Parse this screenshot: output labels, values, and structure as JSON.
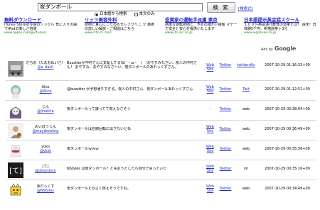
{
  "search": {
    "query": "炭ダンボール",
    "button_label": "検 索",
    "help_link": "[検索式]",
    "option_japanese": "日本語から検索",
    "option_fulltext": "本文のみ"
  },
  "ads": [
    {
      "title": "無料ダウンロード",
      "body": "iTunes Storeの今週のシングル 気に入りの曲でiPodの楽しさ倍増",
      "url": "www.apple.com/jp/itunes/"
    },
    {
      "title": "リッツ美容外科",
      "body": "技術と真心にこだわるセレブクリニ ク 施術の詳しい解説・ご相談はこちら",
      "url": "www.ritz-cs.com"
    },
    {
      "title": "投資家の運転手派遣 東京",
      "body": "高度な運転技術と、きめの細かい接客 マナーで安全と安心を提供いたします",
      "url": "www.jts-inc.co.jp"
    },
    {
      "title": "日本語提示英会話スクール",
      "body": "１００％英語漬け教育の効果とは？ 週末！日体験5千円、新宿説参ヶ3分",
      "url": "www.eigozuke.co.jp"
    }
  ],
  "ads_by": {
    "prefix": "Ads by",
    "brand": "Google"
  },
  "tweets": [
    {
      "name": "だちお（たまおねいさ）",
      "handle": "@a_dach",
      "text": "Buzztterが中村さんに支配してるね(´・ω・｀) 「おやすみなさい、炭人の中村さん！ おやすみ、おやすみなさ〜い、炭ダンボールのあれっくすさん。",
      "web": "Web Site",
      "twitter": "Twitter",
      "source": "twitterrific",
      "time": "2007-10-29 01:16:33+09"
    },
    {
      "name": "Alce",
      "handle": "@Alice",
      "text": "@buzztter が予想通りすぎる。炭人の中村さん、炭ダンボールあれっくすさん",
      "web": "Web Site",
      "twitter": "Twitter",
      "source": "Twit",
      "time": "2007-10-29 01:12:51+09"
    },
    {
      "name": "じん",
      "handle": "@jinakira",
      "text": "炭ダンボールって誰ってて燃えなさそう",
      "web": "-",
      "twitter": "Twitter",
      "source": "web",
      "time": "2007-10-29 00:38:04+09"
    },
    {
      "name": "めいぼうじん",
      "handle": "@mayibowling",
      "text": "炭ダンボールは右腕回転に出さないとね",
      "web": "Web Site",
      "twitter": "Twitter",
      "source": "web",
      "time": "2007-10-29 00:36:49+09"
    },
    {
      "name": "yoko",
      "handle": "@yksk",
      "text": "炭ダンボールｗｗｗ",
      "web": "Web Site",
      "twitter": "Twitter",
      "source": "web",
      "time": "2007-10-29 00:35:36+09"
    },
    {
      "name": "[て]",
      "handle": "@dnsystem",
      "text": "NStyles は炭ダンボール？と言おうとしたら自分で言っていた",
      "web": "Web Site",
      "twitter": "Twitter",
      "source": "im",
      "time": "2007-10-29 00:35:16+09"
    },
    {
      "name": "あれっくす",
      "handle": "@NStyles",
      "text": "炭ダンボールとかよく燃えそうですね。",
      "web": "Web Site",
      "twitter": "Twitter",
      "source": "web",
      "time": "2007-10-29 00:34:49+09"
    }
  ]
}
